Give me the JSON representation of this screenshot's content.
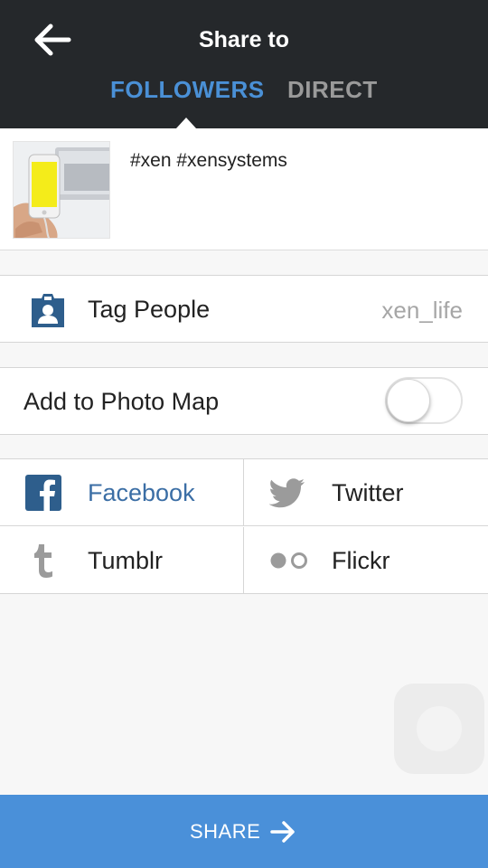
{
  "header": {
    "title": "Share to",
    "tabs": [
      {
        "label": "FOLLOWERS",
        "active": true
      },
      {
        "label": "DIRECT",
        "active": false
      }
    ]
  },
  "caption": {
    "text": "#xen #xensystems"
  },
  "tag_people": {
    "label": "Tag People",
    "value": "xen_life",
    "icon": "person-badge-icon"
  },
  "photo_map": {
    "label": "Add to Photo Map",
    "enabled": false
  },
  "share_targets": [
    {
      "label": "Facebook",
      "icon": "facebook-icon",
      "active": true
    },
    {
      "label": "Twitter",
      "icon": "twitter-icon",
      "active": false
    },
    {
      "label": "Tumblr",
      "icon": "tumblr-icon",
      "active": false
    },
    {
      "label": "Flickr",
      "icon": "flickr-icon",
      "active": false
    }
  ],
  "footer": {
    "share_label": "SHARE"
  },
  "colors": {
    "header_bg": "#25282b",
    "accent": "#4a90d9",
    "facebook": "#3b5998"
  }
}
